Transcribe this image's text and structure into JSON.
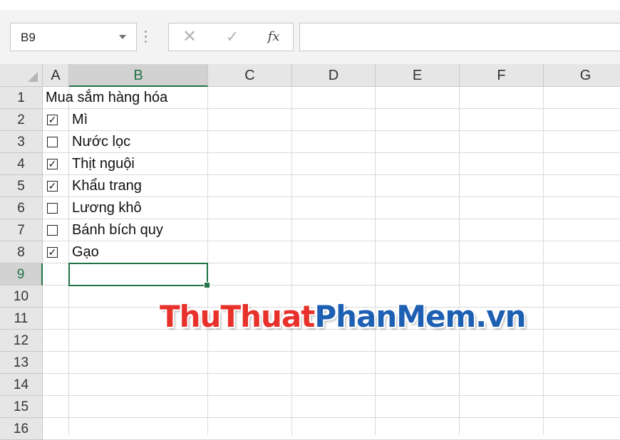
{
  "name_box": {
    "value": "B9"
  },
  "formula_bar": {
    "cancel_icon": "✕",
    "enter_icon": "✓",
    "fx_label": "fx",
    "value": ""
  },
  "columns": [
    "A",
    "B",
    "C",
    "D",
    "E",
    "F",
    "G"
  ],
  "rows": [
    "1",
    "2",
    "3",
    "4",
    "5",
    "6",
    "7",
    "8",
    "9",
    "10",
    "11",
    "12",
    "13",
    "14",
    "15",
    "16"
  ],
  "selected": {
    "column": "B",
    "row": "9"
  },
  "cells": {
    "A1": "Mua sắm hàng hóa",
    "B2": "Mì",
    "B3": "Nước lọc",
    "B4": "Thịt nguội",
    "B5": "Khẩu trang",
    "B6": "Lương khô",
    "B7": "Bánh bích quy",
    "B8": "Gạo"
  },
  "checkboxes": [
    {
      "row": "2",
      "checked": true,
      "mark": "✓"
    },
    {
      "row": "3",
      "checked": false,
      "mark": ""
    },
    {
      "row": "4",
      "checked": true,
      "mark": "✓"
    },
    {
      "row": "5",
      "checked": true,
      "mark": "✓"
    },
    {
      "row": "6",
      "checked": false,
      "mark": ""
    },
    {
      "row": "7",
      "checked": false,
      "mark": ""
    },
    {
      "row": "8",
      "checked": true,
      "mark": "✓"
    }
  ],
  "watermark": {
    "part1": "ThuThuat",
    "part2": "PhanMem.vn"
  },
  "colors": {
    "accent": "#217346",
    "watermark_red": "#e8312a",
    "watermark_blue": "#1c5fb3"
  }
}
